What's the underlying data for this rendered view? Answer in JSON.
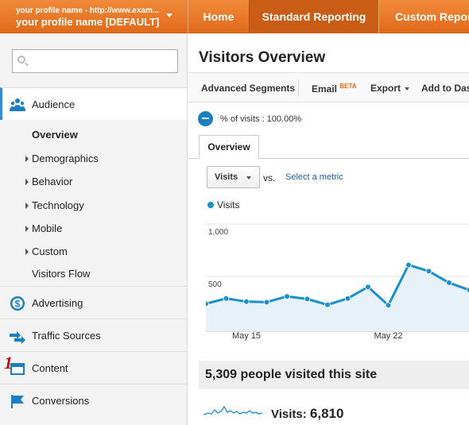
{
  "topbar": {
    "profile_line1": "your profile name - http://www.exam...",
    "profile_line2": "your profile name [DEFAULT]",
    "tabs": [
      "Home",
      "Standard Reporting",
      "Custom Reporti"
    ],
    "active_tab": "Standard Reporting",
    "bar_color": "#e87826",
    "active_color": "#c95d15"
  },
  "sidebar": {
    "search_placeholder": "",
    "audience": {
      "label": "Audience",
      "items": [
        "Overview",
        "Demographics",
        "Behavior",
        "Technology",
        "Mobile",
        "Custom",
        "Visitors Flow"
      ],
      "active_item": "Overview"
    },
    "sections": [
      "Advertising",
      "Traffic Sources",
      "Content",
      "Conversions"
    ],
    "annotation_number": "1"
  },
  "main": {
    "title": "Visitors Overview",
    "toolbar": {
      "advanced_segments": "Advanced Segments",
      "email": "Email",
      "email_badge": "BETA",
      "export": "Export",
      "add_to": "Add to Das"
    },
    "segment_text": "% of visits : 100.00%",
    "tab": "Overview",
    "metric_button": "Visits",
    "vs": "vs.",
    "select_metric": "Select a metric",
    "legend": "Visits",
    "summary": "5,309 people visited this site",
    "visits_label": "Visits:",
    "visits_value": "6,810"
  },
  "chart_data": {
    "type": "area",
    "series": [
      {
        "name": "Visits",
        "color": "#1a8fcc",
        "values": [
          240,
          290,
          260,
          255,
          310,
          285,
          230,
          290,
          400,
          225,
          610,
          550,
          440,
          370
        ]
      }
    ],
    "yticks": [
      "1,000",
      "500"
    ],
    "xticks": [
      "May 15",
      "May 22"
    ],
    "ylim": [
      0,
      1000
    ],
    "grid": true
  }
}
